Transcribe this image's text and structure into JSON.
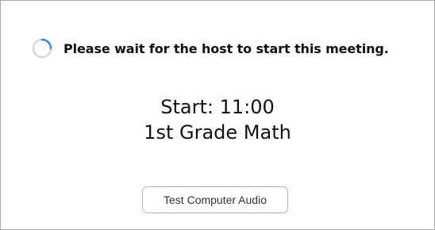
{
  "status": {
    "icon": "loading-spinner-icon",
    "message": "Please wait for the host to start this meeting."
  },
  "meeting": {
    "start": "Start: 11:00",
    "topic": "1st Grade Math"
  },
  "actions": {
    "test_audio_label": "Test Computer Audio"
  },
  "colors": {
    "spinner_track": "#d6d6d6",
    "spinner_arc": "#2d8cff",
    "text": "#111111",
    "border": "#a8a8a8"
  }
}
